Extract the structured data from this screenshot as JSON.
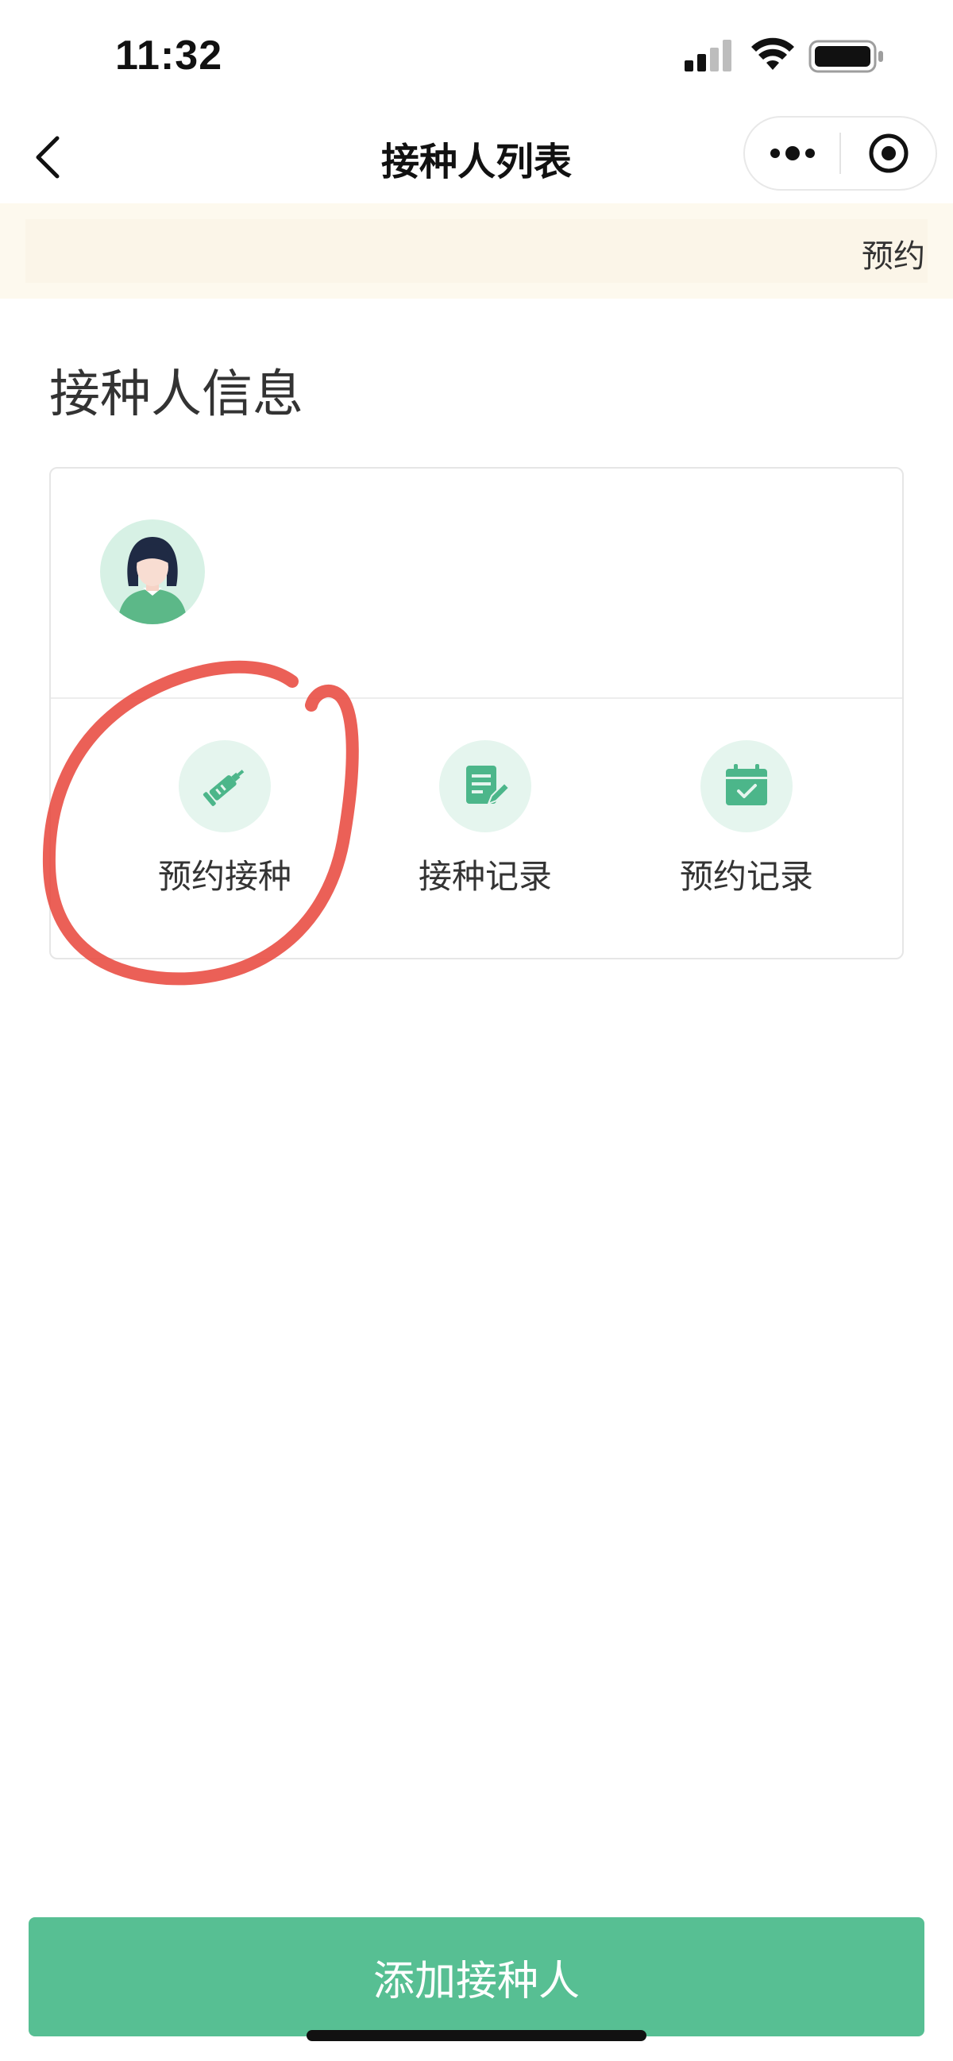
{
  "status_bar": {
    "time": "11:32"
  },
  "nav": {
    "title": "接种人列表"
  },
  "notice": {
    "text": "预约"
  },
  "section": {
    "title": "接种人信息"
  },
  "card": {
    "actions": [
      {
        "label": "预约接种",
        "icon": "vaccine-syringe-icon"
      },
      {
        "label": "接种记录",
        "icon": "record-edit-icon"
      },
      {
        "label": "预约记录",
        "icon": "calendar-check-icon"
      }
    ]
  },
  "footer": {
    "add_button_label": "添加接种人"
  },
  "colors": {
    "accent_green": "#57bf93",
    "icon_green": "#4cb68a",
    "icon_bg": "#e5f5ee",
    "notice_bg": "#fdf9ee",
    "annotation_red": "#e8443a"
  }
}
